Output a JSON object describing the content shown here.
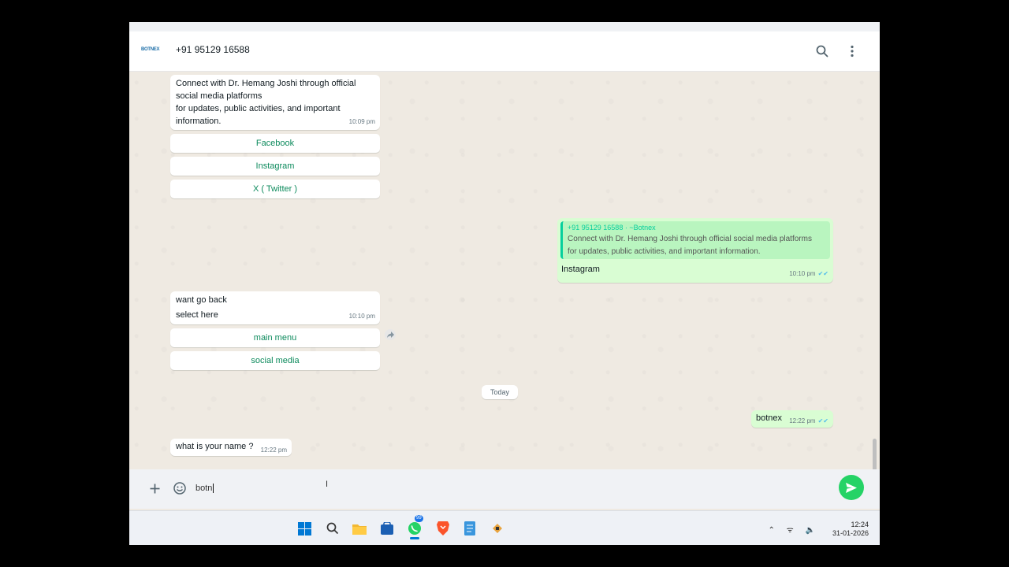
{
  "header": {
    "logo_text": "BOTNEX",
    "contact_name": "+91 95129 16588",
    "search_icon": "search-icon",
    "menu_icon": "more-vertical-icon"
  },
  "messages": {
    "m1": {
      "lines": [
        "Connect with Dr. Hemang Joshi through official",
        "social media platforms",
        "for updates, public activities, and important",
        "information."
      ],
      "time": "10:09 pm",
      "buttons": [
        "Facebook",
        "Instagram",
        "X ( Twitter )"
      ]
    },
    "m2": {
      "quote_author": "+91 95129 16588 · ~Botnex",
      "quote_lines": [
        "Connect with Dr. Hemang Joshi through official social media platforms",
        "for updates, public activities, and important information."
      ],
      "text": "Instagram",
      "time": "10:10 pm"
    },
    "m3": {
      "title": "want go back",
      "subtitle": "select here",
      "time": "10:10 pm",
      "buttons": [
        "main menu",
        "social media"
      ]
    },
    "date_divider": "Today",
    "m4": {
      "text": "botnex",
      "time": "12:22 pm"
    },
    "m5": {
      "text": "what is your name ?",
      "time": "12:22 pm"
    }
  },
  "composer": {
    "value": "botn",
    "plus_icon": "plus-icon",
    "emoji_icon": "emoji-icon",
    "send_icon": "send-icon"
  },
  "taskbar": {
    "icons": [
      "windows-start-icon",
      "search-icon",
      "file-explorer-icon",
      "store-icon",
      "whatsapp-icon",
      "brave-icon",
      "notepad-icon",
      "app-icon"
    ],
    "badge": "99",
    "time": "12:24",
    "date": "31-01-2026"
  },
  "colors": {
    "accent": "#25d366",
    "outgoing": "#d9fdd3",
    "link": "#0c8a5c"
  }
}
